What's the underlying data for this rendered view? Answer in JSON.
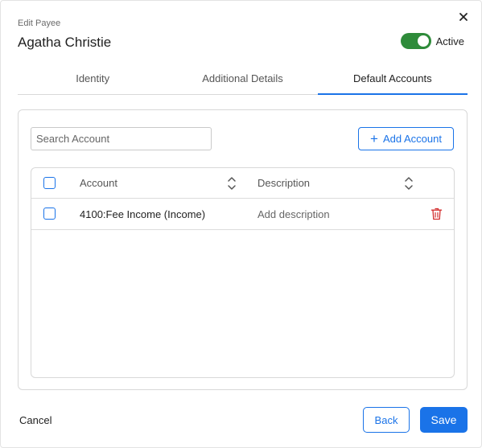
{
  "header": {
    "subtitle": "Edit Payee",
    "title": "Agatha Christie",
    "close_icon": "close-icon",
    "status_label": "Active",
    "status_on": true
  },
  "tabs": [
    {
      "label": "Identity",
      "active": false
    },
    {
      "label": "Additional Details",
      "active": false
    },
    {
      "label": "Default Accounts",
      "active": true
    }
  ],
  "panel": {
    "search_placeholder": "Search Account",
    "search_value": "",
    "add_button_label": "Add Account"
  },
  "table": {
    "columns": {
      "account": "Account",
      "description": "Description"
    },
    "rows": [
      {
        "account": "4100:Fee Income (Income)",
        "description": "Add description",
        "checked": false
      }
    ]
  },
  "footer": {
    "cancel_label": "Cancel",
    "back_label": "Back",
    "save_label": "Save"
  },
  "colors": {
    "accent": "#1a73e8",
    "toggle_on": "#2e8b3a",
    "danger": "#d32f2f"
  }
}
